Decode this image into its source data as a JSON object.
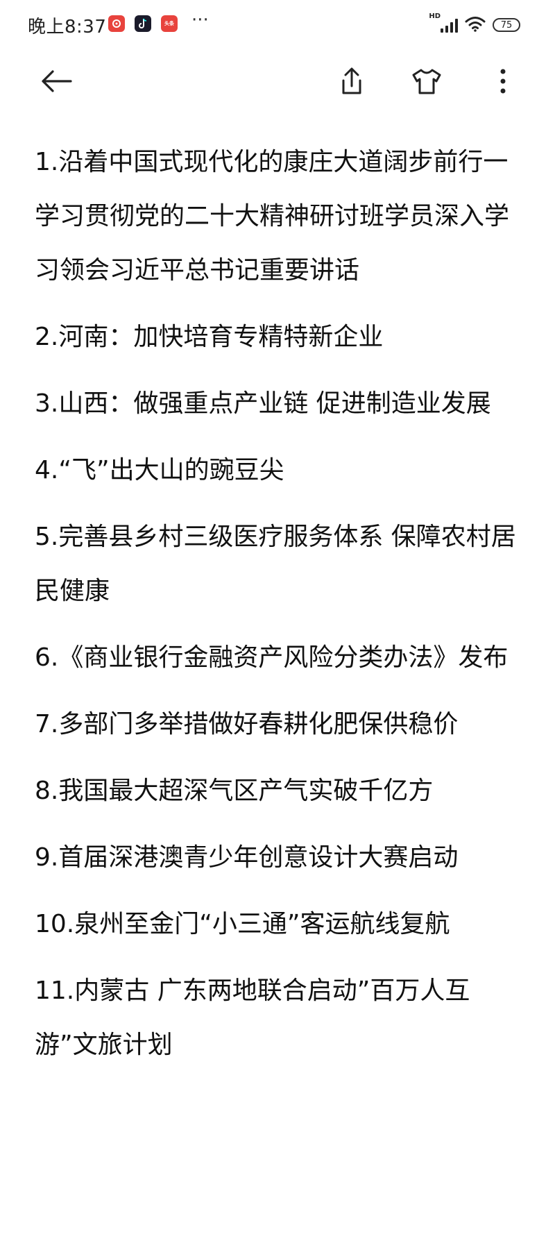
{
  "status_bar": {
    "time": "晚上8:37",
    "notification_icons": [
      "netease-music-icon",
      "tiktok-icon",
      "toutiao-icon"
    ],
    "notif3_text": "头条",
    "more": "···",
    "network_label": "HD",
    "battery": "75"
  },
  "toolbar": {
    "back_icon": "back-arrow-icon",
    "share_icon": "share-icon",
    "theme_icon": "shirt-icon",
    "more_icon": "more-vertical-icon"
  },
  "headlines": [
    "1.沿着中国式现代化的康庄大道阔步前行一学习贯彻党的二十大精神研讨班学员深入学习领会习近平总书记重要讲话",
    "2.河南：加快培育专精特新企业",
    "3.山西：做强重点产业链 促进制造业发展",
    "4.“飞”出大山的豌豆尖",
    "5.完善县乡村三级医疗服务体系 保障农村居民健康",
    "6.《商业银行金融资产风险分类办法》发布",
    "7.多部门多举措做好春耕化肥保供稳价",
    "8.我国最大超深气区产气实破千亿方",
    "9.首届深港澳青少年创意设计大赛启动",
    "10.泉州至金门“小三通”客运航线复航",
    "11.内蒙古 广东两地联合启动”百万人互游”文旅计划"
  ]
}
